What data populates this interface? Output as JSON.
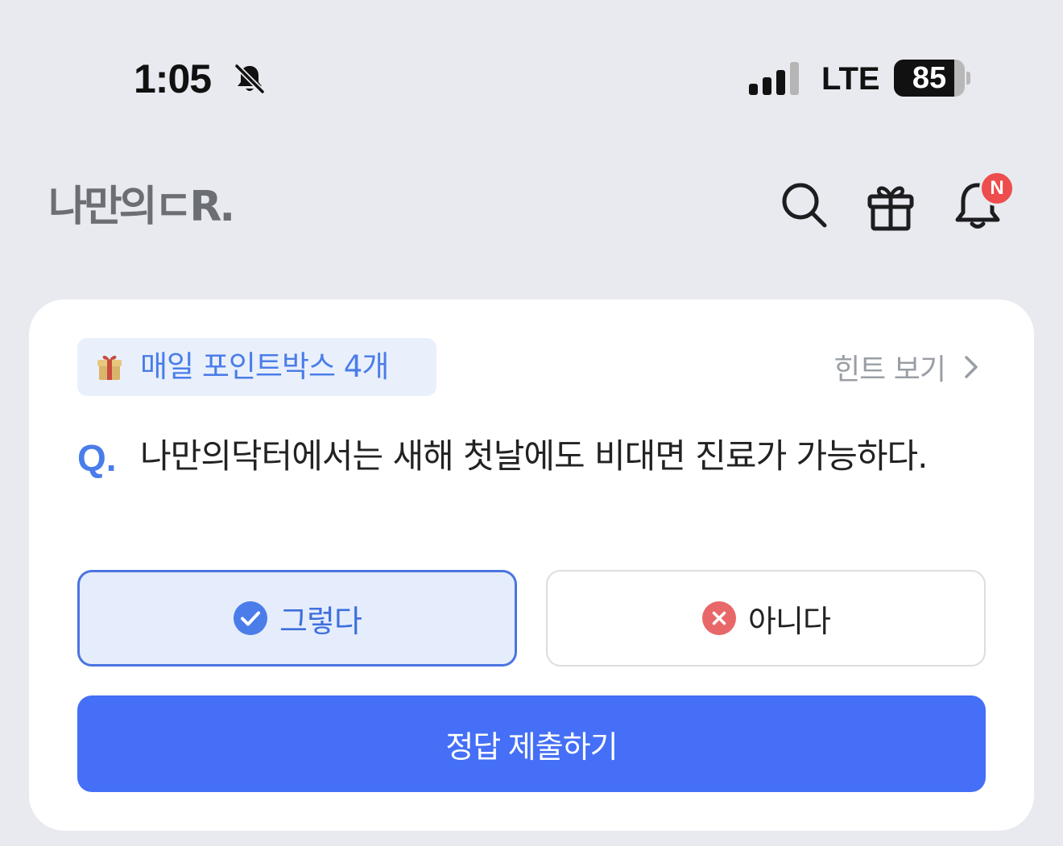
{
  "status_bar": {
    "time": "1:05",
    "mute_icon": "bell-slash-icon",
    "signal_icon": "cellular-signal-icon",
    "network": "LTE",
    "battery_percent": 85
  },
  "header": {
    "logo_text": "나만의ㄷR.",
    "icons": [
      "search-icon",
      "gift-icon",
      "bell-icon"
    ],
    "notification_badge": "N"
  },
  "quiz": {
    "point_badge": {
      "icon": "gift-emoji-icon",
      "label": "매일 포인트박스 4개"
    },
    "hint": {
      "label": "힌트 보기",
      "icon": "chevron-right-icon"
    },
    "question_marker": "Q.",
    "question_text": "나만의닥터에서는 새해 첫날에도 비대면 진료가 가능하다.",
    "options": [
      {
        "label": "그렇다",
        "icon": "check-circle-icon",
        "selected": true
      },
      {
        "label": "아니다",
        "icon": "x-circle-icon",
        "selected": false
      }
    ],
    "submit_label": "정답 제출하기"
  },
  "colors": {
    "background": "#e8eaef",
    "primary": "#446ff6",
    "accent_text": "#4b7de8",
    "selected_option_bg": "#e5edfc",
    "wrong_icon": "#e8686a",
    "badge": "#ee4d4d"
  }
}
